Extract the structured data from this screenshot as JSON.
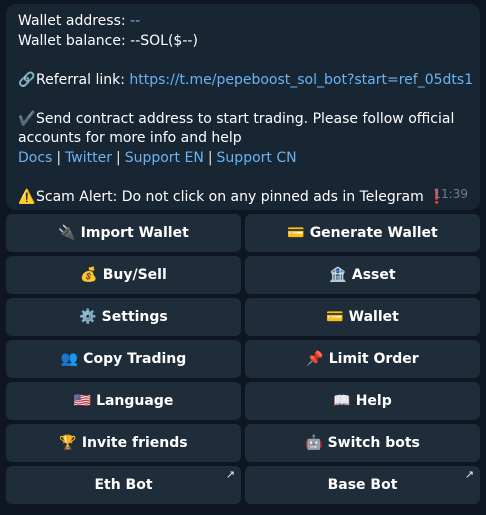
{
  "message": {
    "wallet_address_label": "Wallet address:",
    "wallet_address_value": "--",
    "wallet_balance_label": "Wallet balance:",
    "wallet_balance_value": "--SOL($--)",
    "referral_icon": "🔗",
    "referral_label": "Referral link:",
    "referral_url": "https://t.me/pepeboost_sol_bot?start=ref_05dts1",
    "check_icon": "✔️",
    "instruction": "Send contract address to start trading. Please follow official",
    "instruction_cont": "accounts for more info and help",
    "links": [
      "Docs",
      "Twitter",
      "Support EN",
      "Support CN"
    ],
    "separator": "|",
    "warning_icon": "⚠️",
    "scam_alert": "Scam Alert: Do not click on any pinned ads in Telegram",
    "exclaim_icon": "❗",
    "time": "11:39"
  },
  "keyboard": [
    [
      {
        "icon": "🔌",
        "label": "Import Wallet"
      },
      {
        "icon": "💳",
        "label": "Generate Wallet"
      }
    ],
    [
      {
        "icon": "💰",
        "label": "Buy/Sell"
      },
      {
        "icon": "🏦",
        "label": "Asset"
      }
    ],
    [
      {
        "icon": "⚙️",
        "label": "Settings"
      },
      {
        "icon": "💳",
        "label": "Wallet"
      }
    ],
    [
      {
        "icon": "👥",
        "label": "Copy Trading"
      },
      {
        "icon": "📌",
        "label": "Limit Order"
      }
    ],
    [
      {
        "icon": "🇺🇸",
        "label": "Language"
      },
      {
        "icon": "📖",
        "label": "Help"
      }
    ],
    [
      {
        "icon": "🏆",
        "label": "Invite friends"
      },
      {
        "icon": "🤖",
        "label": "Switch bots"
      }
    ],
    [
      {
        "icon": "",
        "label": "Eth Bot",
        "corner": "↗"
      },
      {
        "icon": "",
        "label": "Base Bot",
        "corner": "↗"
      }
    ]
  ]
}
